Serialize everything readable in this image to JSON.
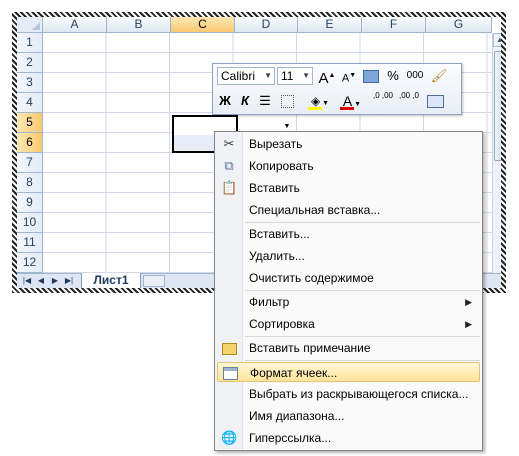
{
  "columns": [
    "A",
    "B",
    "C",
    "D",
    "E",
    "F",
    "G"
  ],
  "rows": [
    "1",
    "2",
    "3",
    "4",
    "5",
    "6",
    "7",
    "8",
    "9",
    "10",
    "11",
    "12"
  ],
  "selected_column": "C",
  "selected_rows": [
    "5",
    "6"
  ],
  "sheet_tab": "Лист1",
  "mini_toolbar": {
    "font_name": "Calibri",
    "font_size": "11",
    "bold": "Ж",
    "italic": "К",
    "percent": "%",
    "thousands": "000",
    "grow_font": "A",
    "shrink_font": "A",
    "font_color_letter": "A",
    "decimal_inc": ",0 ,00",
    "decimal_dec": ",00 ,0"
  },
  "context_menu": {
    "cut": "Вырезать",
    "copy": "Копировать",
    "paste": "Вставить",
    "paste_special": "Специальная вставка...",
    "insert": "Вставить...",
    "delete": "Удалить...",
    "clear_contents": "Очистить содержимое",
    "filter": "Фильтр",
    "sort": "Сортировка",
    "insert_comment": "Вставить примечание",
    "format_cells": "Формат ячеек...",
    "pick_from_list": "Выбрать из раскрывающегося списка...",
    "range_name": "Имя диапазона...",
    "hyperlink": "Гиперссылка..."
  },
  "colors": {
    "header_selected": "#f9c971",
    "menu_highlight": "#ffe39a",
    "font_color_bar": "#e00000",
    "fill_color_bar": "#ffff00"
  }
}
